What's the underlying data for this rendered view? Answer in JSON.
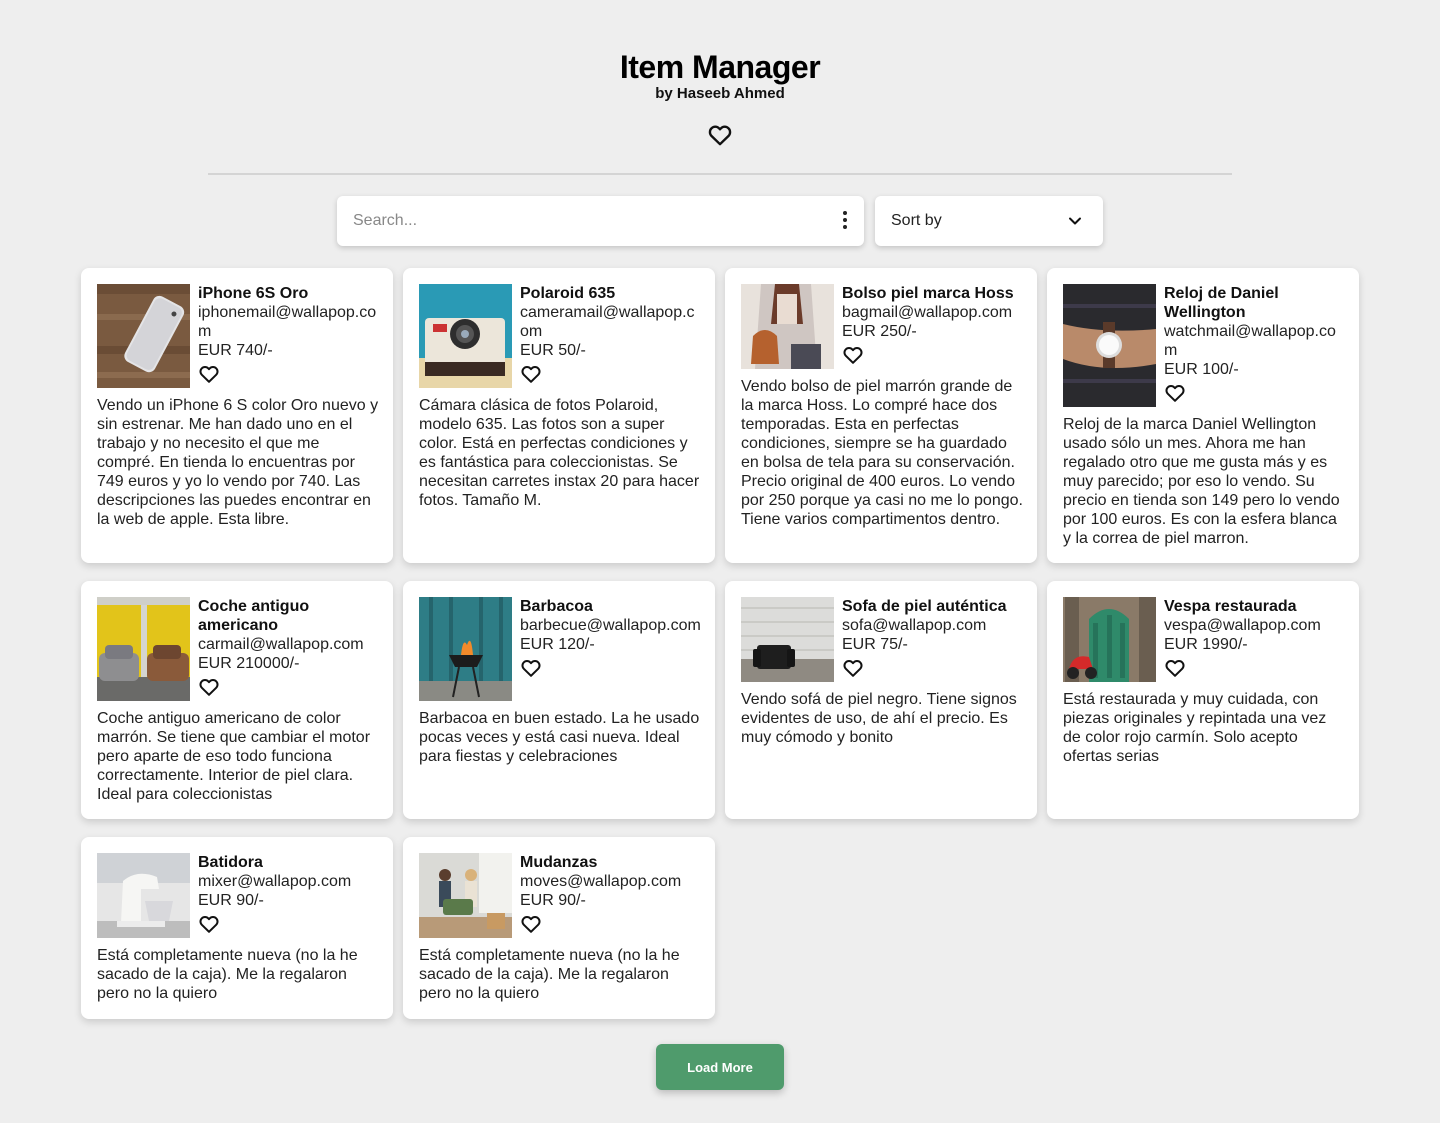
{
  "header": {
    "title": "Item Manager",
    "subtitle": "by Haseeb Ahmed",
    "favorites_icon": "heart-outline-icon"
  },
  "search": {
    "placeholder": "Search...",
    "value": "",
    "menu_icon": "more-vertical-icon"
  },
  "sort": {
    "label": "Sort by",
    "icon": "chevron-down-icon"
  },
  "items": [
    {
      "title": "iPhone 6S Oro",
      "email": "iphonemail@wallapop.com",
      "price": "EUR 740/-",
      "description": "Vendo un iPhone 6 S color Oro nuevo y sin estrenar. Me han dado uno en el trabajo y no necesito el que me compré. En tienda lo encuentras por 749 euros y yo lo vendo por 740. Las descripciones las puedes encontrar en la web de apple. Esta libre."
    },
    {
      "title": "Polaroid 635",
      "email": "cameramail@wallapop.com",
      "price": "EUR 50/-",
      "description": "Cámara clásica de fotos Polaroid, modelo 635. Las fotos son a super color. Está en perfectas condiciones y es fantástica para coleccionistas. Se necesitan carretes instax 20 para hacer fotos. Tamaño M."
    },
    {
      "title": "Bolso piel marca Hoss",
      "email": "bagmail@wallapop.com",
      "price": "EUR 250/-",
      "description": "Vendo bolso de piel marrón grande de la marca Hoss. Lo compré hace dos temporadas. Esta en perfectas condiciones, siempre se ha guardado en bolsa de tela para su conservación. Precio original de 400 euros. Lo vendo por 250 porque ya casi no me lo pongo. Tiene varios compartimentos dentro."
    },
    {
      "title": "Reloj de Daniel Wellington",
      "email": "watchmail@wallapop.com",
      "price": "EUR 100/-",
      "description": "Reloj de la marca Daniel Wellington usado sólo un mes. Ahora me han regalado otro que me gusta más y es muy parecido; por eso lo vendo. Su precio en tienda son 149 pero lo vendo por 100 euros. Es con la esfera blanca y la correa de piel marron."
    },
    {
      "title": "Coche antiguo americano",
      "email": "carmail@wallapop.com",
      "price": "EUR 210000/-",
      "description": "Coche antiguo americano de color marrón. Se tiene que cambiar el motor pero aparte de eso todo funciona correctamente. Interior de piel clara. Ideal para coleccionistas"
    },
    {
      "title": "Barbacoa",
      "email": "barbecue@wallapop.com",
      "price": "EUR 120/-",
      "description": "Barbacoa en buen estado. La he usado pocas veces y está casi nueva. Ideal para fiestas y celebraciones"
    },
    {
      "title": "Sofa de piel auténtica",
      "email": "sofa@wallapop.com",
      "price": "EUR 75/-",
      "description": "Vendo sofá de piel negro. Tiene signos evidentes de uso, de ahí el precio. Es muy cómodo y bonito"
    },
    {
      "title": "Vespa restaurada",
      "email": "vespa@wallapop.com",
      "price": "EUR 1990/-",
      "description": "Está restaurada y muy cuidada, con piezas originales y repintada una vez de color rojo carmín. Solo acepto ofertas serias"
    },
    {
      "title": "Batidora",
      "email": "mixer@wallapop.com",
      "price": "EUR 90/-",
      "description": "Está completamente nueva (no la he sacado de la caja). Me la regalaron pero no la quiero"
    },
    {
      "title": "Mudanzas",
      "email": "moves@wallapop.com",
      "price": "EUR 90/-",
      "description": "Está completamente nueva (no la he sacado de la caja). Me la regalaron pero no la quiero"
    }
  ],
  "load_more": {
    "label": "Load More",
    "color": "#4f9b6c"
  }
}
